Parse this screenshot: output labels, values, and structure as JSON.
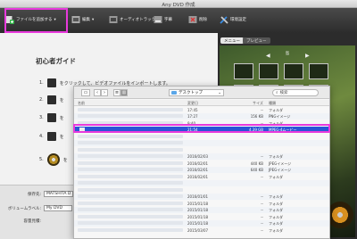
{
  "window": {
    "title": "Any DVD 作成"
  },
  "toolbar": {
    "add_label": "ファイルを追加する",
    "edit_label": "編集",
    "audio_label": "オーディオトラック",
    "subtitle_label": "字幕",
    "delete_label": "削除",
    "settings_label": "環境設定"
  },
  "guide": {
    "title": "初心者ガイド",
    "steps": [
      {
        "num": "1.",
        "text": "をクリックして、ビデオファイルをインポートします。"
      },
      {
        "num": "2.",
        "text": "を"
      },
      {
        "num": "3.",
        "text": "を"
      },
      {
        "num": "4.",
        "text": "を"
      },
      {
        "num": "5.",
        "text": "を"
      }
    ]
  },
  "form": {
    "save_label": "保存先:",
    "save_value": "MATSHITA D",
    "volume_label": "ボリュームラベル:",
    "volume_value": "My DVD",
    "capacity_label": "容量見積:"
  },
  "preview": {
    "menu_tab": "メニュー",
    "preview_tab": "プレビュー",
    "menu_title": "島"
  },
  "dialog": {
    "location": "デスクトップ",
    "search_placeholder": "検索",
    "columns": {
      "name": "名前",
      "date": "変更日",
      "size": "サイズ",
      "kind": "種類"
    },
    "rows": [
      {
        "date": "17:45",
        "size": "--",
        "kind": "フォルダ"
      },
      {
        "date": "17:27",
        "size": "156 KB",
        "kind": "PNGイメージ"
      },
      {
        "date": "9:40",
        "size": "--",
        "kind": "フォルダ"
      },
      {
        "date": "21:54",
        "size": "4.39 GB",
        "kind": "MPEG-4ムービー",
        "selected": true
      },
      {
        "date": "",
        "size": "",
        "kind": ""
      },
      {
        "date": "",
        "size": "",
        "kind": ""
      },
      {
        "date": "",
        "size": "",
        "kind": ""
      },
      {
        "date": "2016/02/03",
        "size": "--",
        "kind": "フォルダ"
      },
      {
        "date": "2016/02/01",
        "size": "440 KB",
        "kind": "JPEGイメージ"
      },
      {
        "date": "2016/02/01",
        "size": "640 KB",
        "kind": "JPEGイメージ"
      },
      {
        "date": "2016/02/01",
        "size": "--",
        "kind": "フォルダ"
      },
      {
        "date": "",
        "size": "",
        "kind": ""
      },
      {
        "date": "",
        "size": "",
        "kind": ""
      },
      {
        "date": "2016/01/01",
        "size": "--",
        "kind": "フォルダ"
      },
      {
        "date": "2015/01/18",
        "size": "--",
        "kind": "フォルダ"
      },
      {
        "date": "2015/01/18",
        "size": "--",
        "kind": "フォルダ"
      },
      {
        "date": "2015/01/18",
        "size": "--",
        "kind": "フォルダ"
      },
      {
        "date": "2015/01/18",
        "size": "--",
        "kind": "フォルダ"
      },
      {
        "date": "2015/03/07",
        "size": "--",
        "kind": "フォルダ"
      }
    ]
  },
  "colors": {
    "toolbar": "#333333",
    "highlight": "#e83adc",
    "selection": "#2a55d6"
  }
}
